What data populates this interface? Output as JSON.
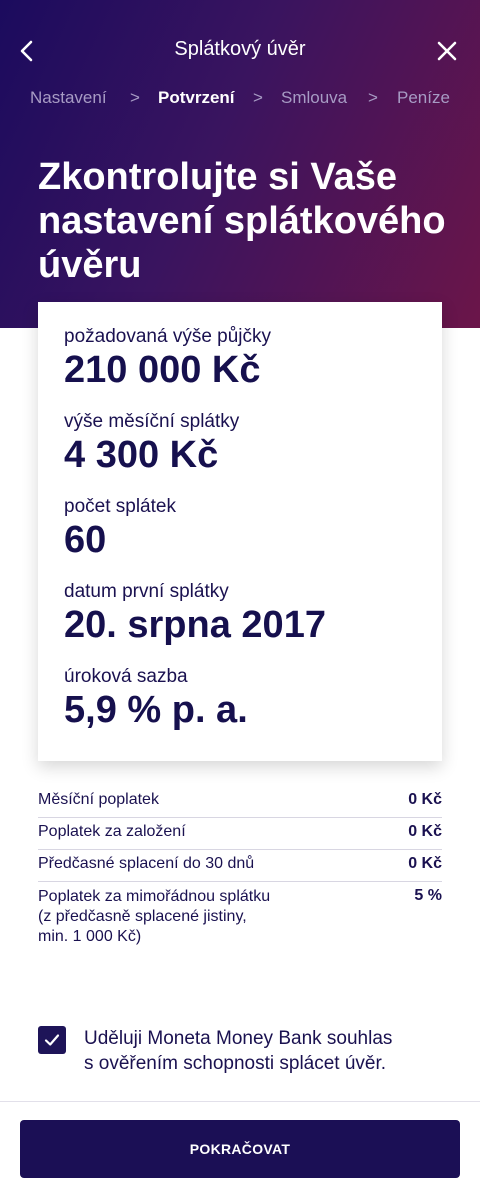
{
  "header": {
    "title": "Splátkový úvěr",
    "back_icon": "chevron-left-icon",
    "close_icon": "close-icon"
  },
  "steps": [
    {
      "label": "Nastavení",
      "active": false
    },
    {
      "label": "Potvrzení",
      "active": true
    },
    {
      "label": "Smlouva",
      "active": false
    },
    {
      "label": "Peníze",
      "active": false
    }
  ],
  "step_separator": ">",
  "headline": "Zkontrolujte si Vaše nastavení splátkového úvěru",
  "summary": {
    "loan_amount": {
      "label": "požadovaná výše půjčky",
      "value": "210 000 Kč"
    },
    "monthly_payment": {
      "label": "výše měsíční splátky",
      "value": "4 300 Kč"
    },
    "installments": {
      "label": "počet splátek",
      "value": "60"
    },
    "first_payment_date": {
      "label": "datum první splátky",
      "value": "20. srpna 2017"
    },
    "interest_rate": {
      "label": "úroková sazba",
      "value": "5,9 % p. a."
    }
  },
  "fees": [
    {
      "label": "Měsíční poplatek",
      "value": "0 Kč"
    },
    {
      "label": "Poplatek za založení",
      "value": "0 Kč"
    },
    {
      "label": "Předčasné splacení do 30 dnů",
      "value": "0 Kč"
    },
    {
      "label": "Poplatek za mimořádnou splátku\n(z předčasně splacené jistiny,\nmin. 1 000 Kč)",
      "value": "5 %"
    }
  ],
  "consent": {
    "checked": true,
    "text": "Uděluji Moneta Money Bank souhlas\ns ověřením schopnosti splácet úvěr."
  },
  "cta": {
    "label": "POKRAČOVAT"
  },
  "colors": {
    "primary": "#1b0f55",
    "gradient_start": "#1b0b5e",
    "gradient_end": "#6b1549",
    "step_inactive": "#a79bc4"
  }
}
